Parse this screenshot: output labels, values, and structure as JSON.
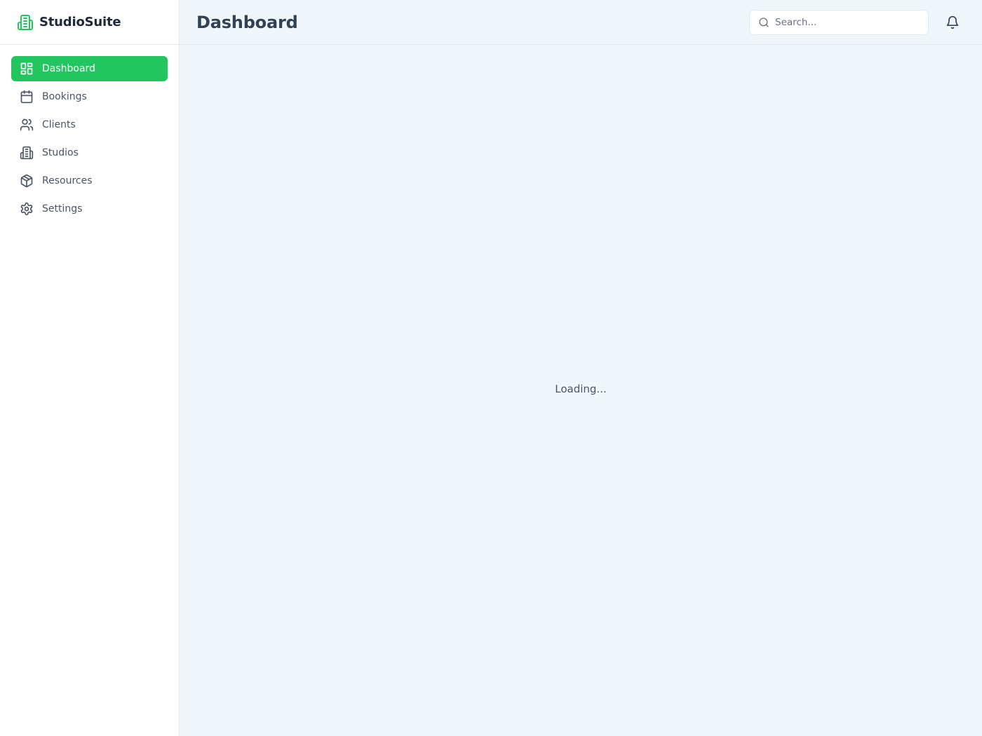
{
  "brand": {
    "name": "StudioSuite",
    "icon": "building-icon",
    "color": "#22c55e"
  },
  "sidebar": {
    "items": [
      {
        "label": "Dashboard",
        "icon": "dashboard-icon",
        "active": true
      },
      {
        "label": "Bookings",
        "icon": "calendar-icon",
        "active": false
      },
      {
        "label": "Clients",
        "icon": "users-icon",
        "active": false
      },
      {
        "label": "Studios",
        "icon": "building-icon",
        "active": false
      },
      {
        "label": "Resources",
        "icon": "box-icon",
        "active": false
      },
      {
        "label": "Settings",
        "icon": "gear-icon",
        "active": false
      }
    ]
  },
  "header": {
    "title": "Dashboard",
    "search": {
      "placeholder": "Search...",
      "value": ""
    },
    "notifications_icon": "bell-icon"
  },
  "main": {
    "status_text": "Loading..."
  },
  "colors": {
    "accent": "#22c55e",
    "background": "#eff6fc",
    "sidebar": "#ffffff"
  }
}
